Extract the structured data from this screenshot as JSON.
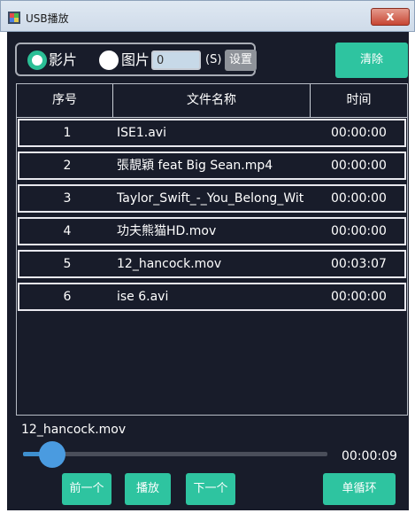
{
  "window": {
    "title": "USB播放",
    "close_label": "x"
  },
  "mode": {
    "options": [
      {
        "label": "影片",
        "selected": true
      },
      {
        "label": "图片",
        "selected": false
      }
    ],
    "interval_value": "0",
    "interval_unit": "(S)",
    "set_label": "设置",
    "clear_label": "清除"
  },
  "file_list": {
    "columns": [
      "序号",
      "文件名称",
      "时间"
    ],
    "rows": [
      {
        "no": "1",
        "name": "ISE1.avi",
        "time": "00:00:00"
      },
      {
        "no": "2",
        "name": "張靚穎 feat Big Sean.mp4",
        "time": "00:00:00"
      },
      {
        "no": "3",
        "name": "Taylor_Swift_-_You_Belong_Wit",
        "time": "00:00:00"
      },
      {
        "no": "4",
        "name": "功夫熊猫HD.mov",
        "time": "00:00:00"
      },
      {
        "no": "5",
        "name": "12_hancock.mov",
        "time": "00:03:07"
      },
      {
        "no": "6",
        "name": "ise 6.avi",
        "time": "00:00:00"
      }
    ]
  },
  "player": {
    "now_playing": "12_hancock.mov",
    "total_time": "00:00:09",
    "progress": 0.06,
    "prev_label": "前一个",
    "play_label": "播放",
    "next_label": "下一个",
    "loop_label": "单循环"
  },
  "colors": {
    "accent": "#2ec4a0",
    "background": "#181c2a",
    "slider": "#4a9be0"
  }
}
